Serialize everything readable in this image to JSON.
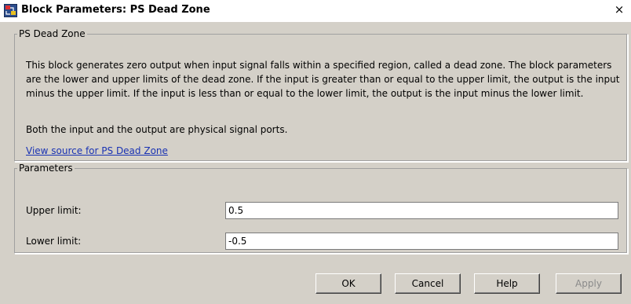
{
  "window": {
    "title": "Block Parameters: PS Dead Zone",
    "icon": "simulink-block-icon",
    "close_glyph": "×"
  },
  "description_group": {
    "legend": "PS Dead Zone",
    "text": "This block generates zero output when input signal falls within a specified region, called a dead zone. The block parameters are the lower and upper limits of the dead zone. If the input is greater than or equal to the upper limit, the output is the input minus the upper limit. If the input is less than or equal to the lower limit, the output is the input minus the lower limit.",
    "ports_text": "Both the input and the output are physical signal ports.",
    "source_link": "View source for PS Dead Zone"
  },
  "parameters_group": {
    "legend": "Parameters",
    "upper_limit": {
      "label": "Upper limit:",
      "value": "0.5"
    },
    "lower_limit": {
      "label": "Lower limit:",
      "value": "-0.5"
    }
  },
  "buttons": {
    "ok": "OK",
    "cancel": "Cancel",
    "help": "Help",
    "apply": "Apply"
  },
  "colors": {
    "link": "#1a33b3",
    "dialog_background": "#d4d0c8"
  }
}
